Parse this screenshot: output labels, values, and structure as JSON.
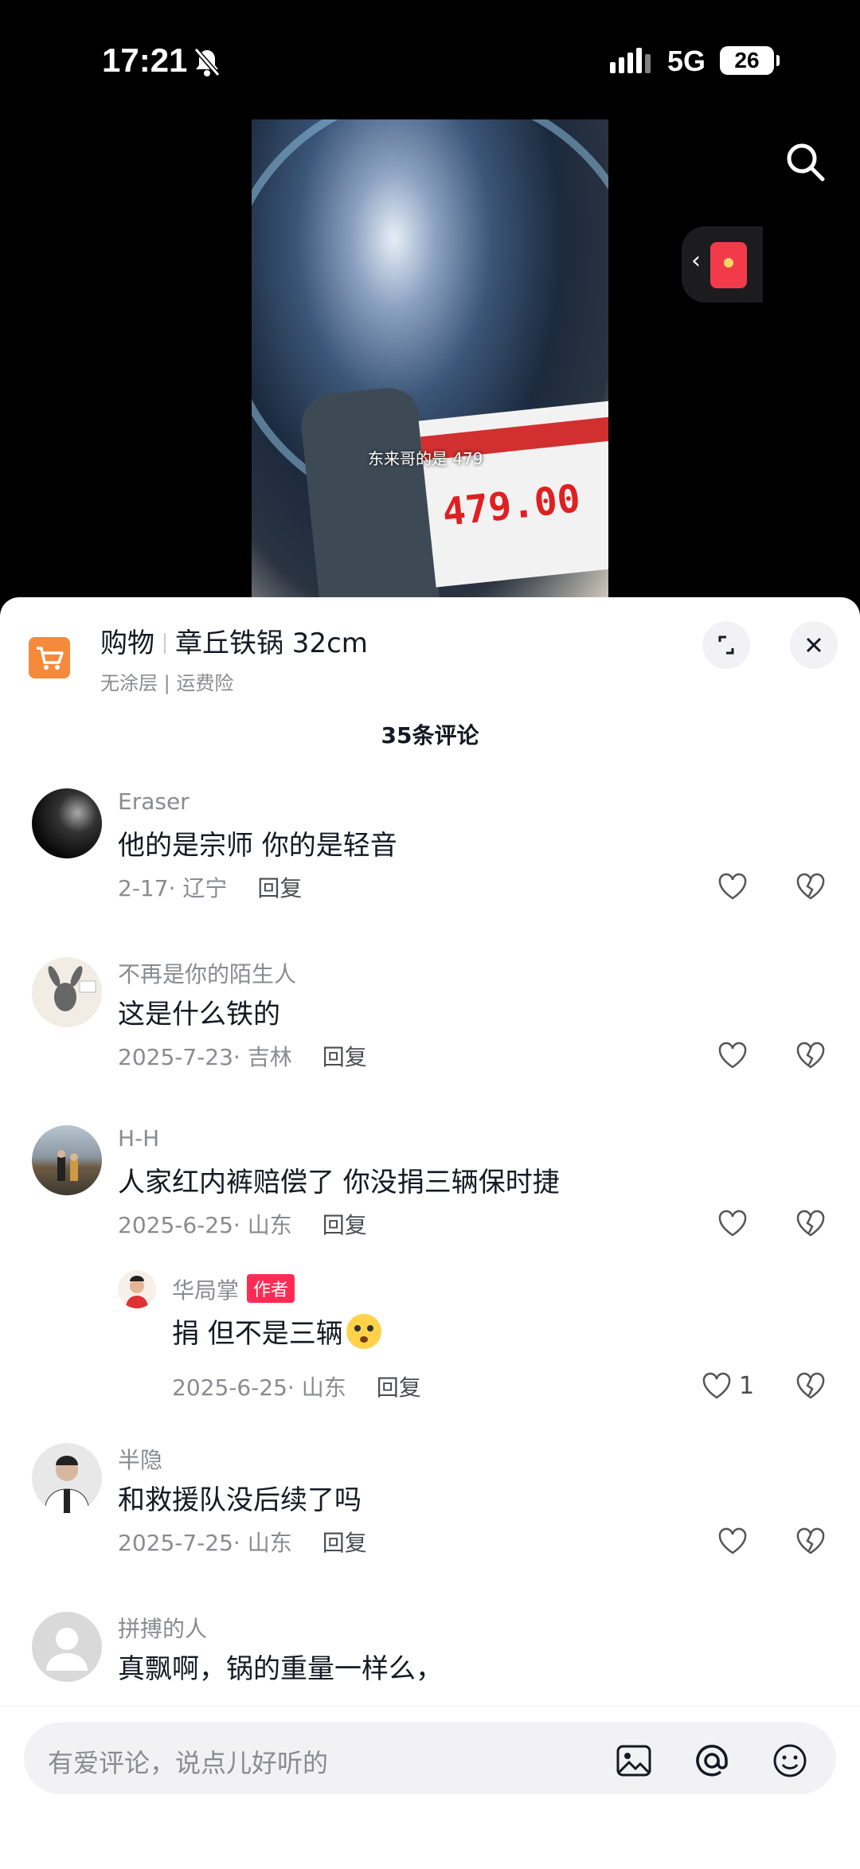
{
  "status_bar": {
    "time": "17:21",
    "network": "5G",
    "battery": "26"
  },
  "video": {
    "price_tag": "479.00",
    "subtitle": "东来哥的是 479"
  },
  "shop": {
    "label": "购物",
    "product": "章丘铁锅 32cm",
    "tags": "无涂层 | 运费险"
  },
  "comments_header": "35条评论",
  "reply_label": "回复",
  "comments": [
    {
      "user": "Eraser",
      "text": "他的是宗师 你的是轻音",
      "meta": "2-17· 辽宁"
    },
    {
      "user": "不再是你的陌生人",
      "text": "这是什么铁的",
      "meta": "2025-7-23· 吉林"
    },
    {
      "user": "H-H",
      "text": "人家红内裤赔偿了 你没捐三辆保时捷",
      "meta": "2025-6-25· 山东"
    },
    {
      "user": "华局掌",
      "badge": "作者",
      "text": "捐 但不是三辆",
      "meta": "2025-6-25· 山东",
      "likes": "1"
    },
    {
      "user": "半隐",
      "text": "和救援队没后续了吗",
      "meta": "2025-7-25· 山东"
    },
    {
      "user": "拼搏的人",
      "text": "真飘啊，锅的重量一样么，"
    }
  ],
  "input": {
    "placeholder": "有爱评论，说点儿好听的"
  },
  "colors": {
    "accent": "#fe2c55",
    "cart": "#f58a3b"
  }
}
